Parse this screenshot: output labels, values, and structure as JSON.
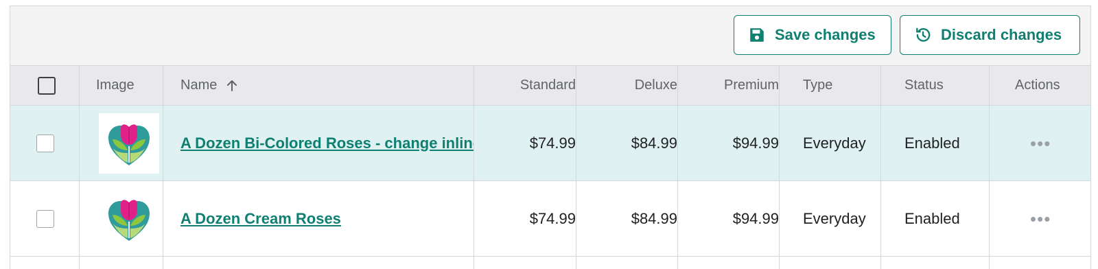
{
  "toolbar": {
    "save_label": "Save changes",
    "discard_label": "Discard changes"
  },
  "columns": {
    "image": "Image",
    "name": "Name",
    "standard": "Standard",
    "deluxe": "Deluxe",
    "premium": "Premium",
    "type": "Type",
    "status": "Status",
    "actions": "Actions"
  },
  "rows": [
    {
      "name": "A Dozen Bi-Colored Roses - change inline",
      "standard": "$74.99",
      "deluxe": "$84.99",
      "premium": "$94.99",
      "type": "Everyday",
      "status": "Enabled",
      "actions": "•••"
    },
    {
      "name": "A Dozen Cream Roses",
      "standard": "$74.99",
      "deluxe": "$84.99",
      "premium": "$94.99",
      "type": "Everyday",
      "status": "Enabled",
      "actions": "•••"
    }
  ],
  "colors": {
    "accent": "#0f7f72",
    "selected_row": "#dff2f1",
    "header_bg": "#e9e9eb"
  },
  "icons": {
    "save": "floppy-disk-icon",
    "discard": "history-icon",
    "sort": "arrow-up-icon",
    "product": "heart-tulip-logo"
  }
}
